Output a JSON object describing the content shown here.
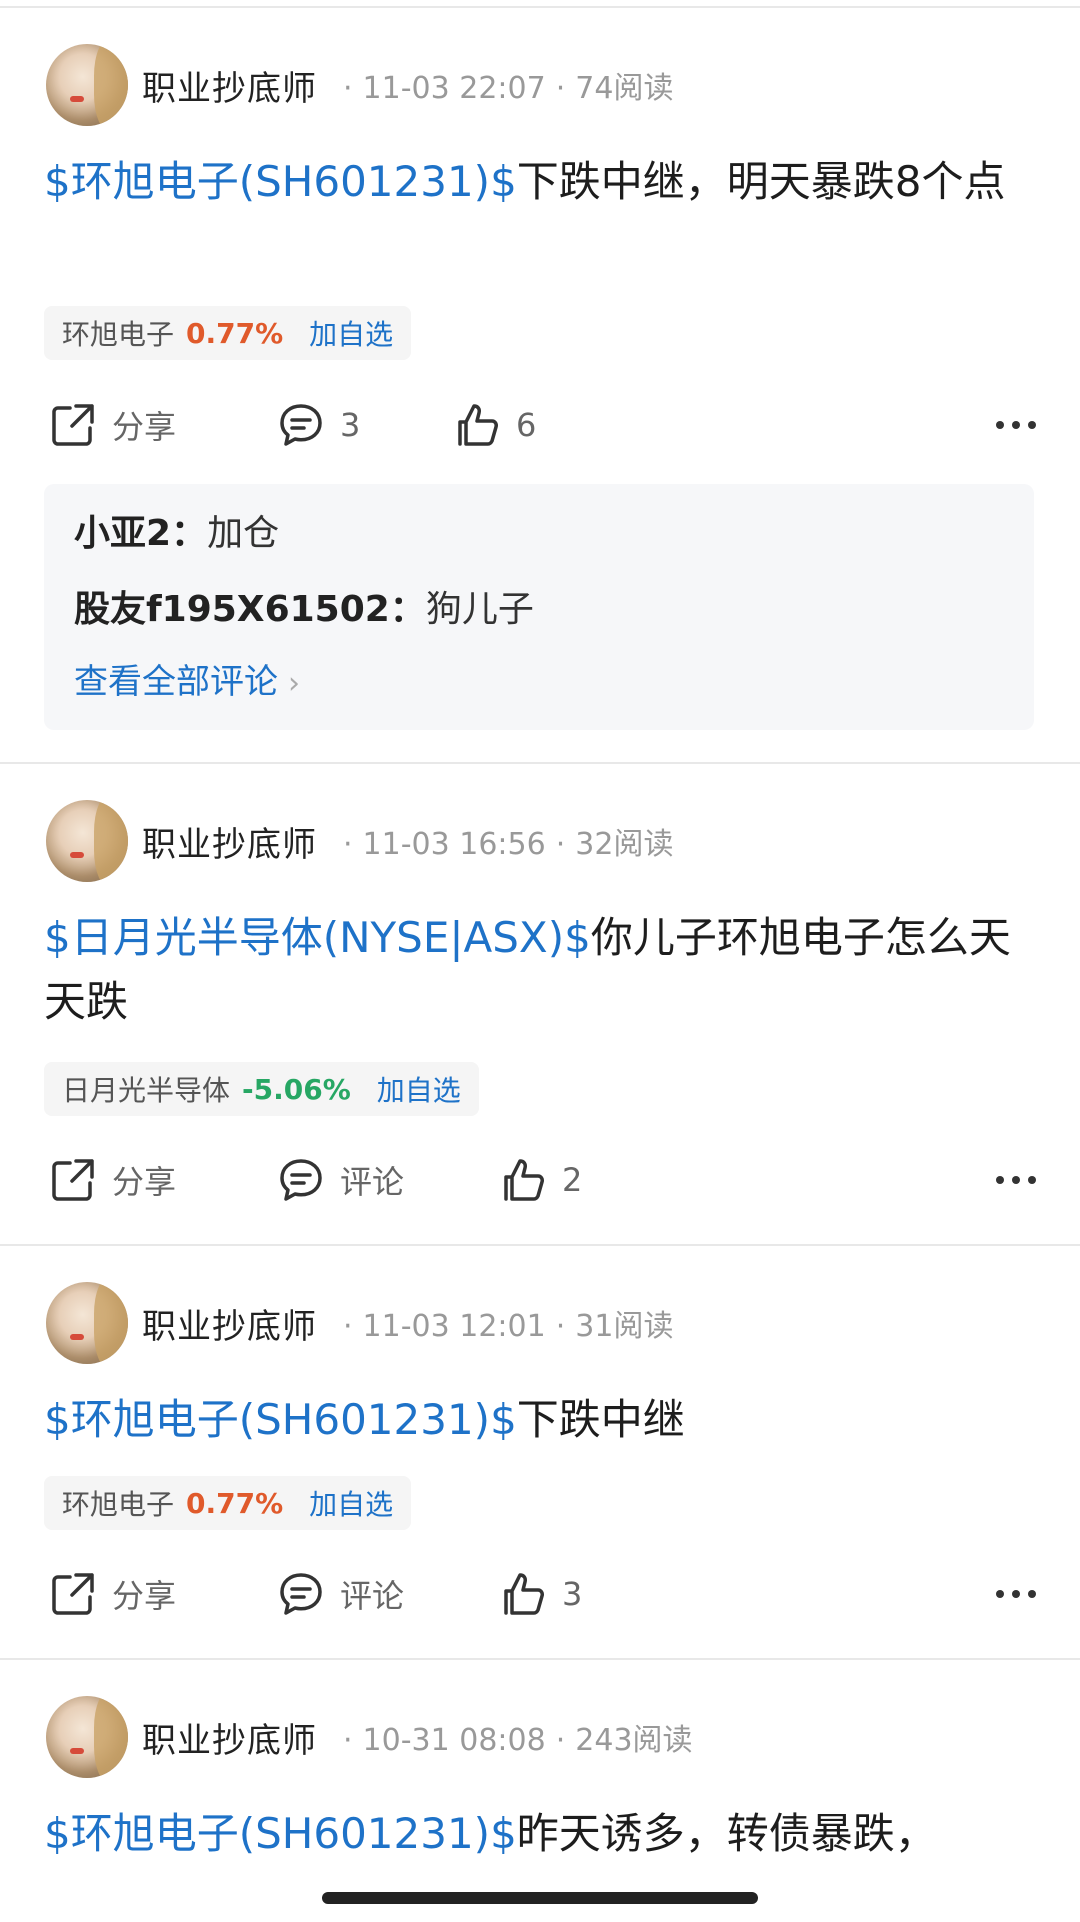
{
  "posts": [
    {
      "author": "职业抄底师",
      "time": "11-03 22:07",
      "reads": "74阅读",
      "stock_tag": "$环旭电子(SH601231)$",
      "text": "下跌中继，明天暴跌8个点",
      "chip": {
        "name": "环旭电子",
        "pct": "0.77%",
        "add": "加自选"
      },
      "share_label": "分享",
      "comment_label": "3",
      "like_count": "6",
      "comments": [
        {
          "who": "小亚2：",
          "text": "加仓"
        },
        {
          "who": "股友f195X61502：",
          "text": "狗儿子"
        }
      ],
      "view_all": "查看全部评论"
    },
    {
      "author": "职业抄底师",
      "time": "11-03 16:56",
      "reads": "32阅读",
      "stock_tag": "$日月光半导体(NYSE|ASX)$",
      "text": "你儿子环旭电子怎么天天跌",
      "chip": {
        "name": "日月光半导体",
        "pct": "-5.06%",
        "add": "加自选"
      },
      "share_label": "分享",
      "comment_label": "评论",
      "like_count": "2"
    },
    {
      "author": "职业抄底师",
      "time": "11-03 12:01",
      "reads": "31阅读",
      "stock_tag": "$环旭电子(SH601231)$",
      "text": "下跌中继",
      "chip": {
        "name": "环旭电子",
        "pct": "0.77%",
        "add": "加自选"
      },
      "share_label": "分享",
      "comment_label": "评论",
      "like_count": "3"
    },
    {
      "author": "职业抄底师",
      "time": "10-31 08:08",
      "reads": "243阅读",
      "stock_tag": "$环旭电子(SH601231)$",
      "text": "昨天诱多，转债暴跌，"
    }
  ],
  "icons": {
    "share": "share-icon",
    "comment": "comment-icon",
    "like": "thumbs-up-icon",
    "more": "more-icon",
    "chevron": "chevron-right-icon"
  },
  "colors": {
    "link": "#1e72c8",
    "up": "#e05a2b",
    "down": "#27a764"
  }
}
